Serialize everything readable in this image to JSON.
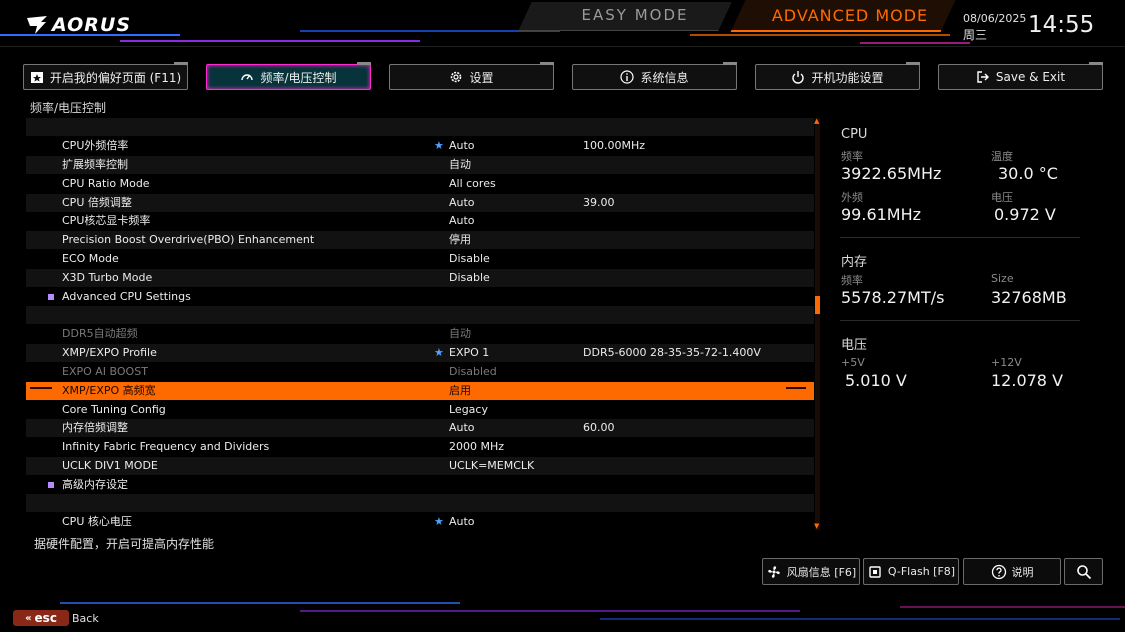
{
  "brand": "AORUS",
  "modes": {
    "easy": "EASY MODE",
    "advanced": "ADVANCED MODE"
  },
  "datetime": {
    "date": "08/06/2025",
    "weekday": "周三",
    "time": "14:55"
  },
  "tabs": [
    {
      "label": "开启我的偏好页面 (F11)",
      "icon": "star-box-icon",
      "active": false
    },
    {
      "label": "频率/电压控制",
      "icon": "gauge-icon",
      "active": true
    },
    {
      "label": "设置",
      "icon": "gear-icon",
      "active": false
    },
    {
      "label": "系统信息",
      "icon": "info-icon",
      "active": false
    },
    {
      "label": "开机功能设置",
      "icon": "power-icon",
      "active": false
    },
    {
      "label": "Save & Exit",
      "icon": "exit-icon",
      "active": false
    }
  ],
  "breadcrumb": "频率/电压控制",
  "settings": [
    {
      "label": "",
      "value": "",
      "extra": ""
    },
    {
      "label": "CPU外频倍率",
      "value": "Auto",
      "extra": "100.00MHz",
      "star": true
    },
    {
      "label": "扩展频率控制",
      "value": "自动",
      "extra": ""
    },
    {
      "label": "CPU Ratio Mode",
      "value": "All cores",
      "extra": ""
    },
    {
      "label": "CPU 倍频调整",
      "value": "Auto",
      "extra": "39.00"
    },
    {
      "label": "CPU核芯显卡频率",
      "value": "Auto",
      "extra": ""
    },
    {
      "label": "Precision Boost Overdrive(PBO) Enhancement",
      "value": "停用",
      "extra": ""
    },
    {
      "label": "ECO Mode",
      "value": "Disable",
      "extra": ""
    },
    {
      "label": "X3D Turbo Mode",
      "value": "Disable",
      "extra": ""
    },
    {
      "label": "Advanced CPU Settings",
      "value": "",
      "extra": "",
      "submenu": true
    },
    {
      "label": "",
      "value": "",
      "extra": ""
    },
    {
      "label": "DDR5自动超频",
      "value": "自动",
      "extra": "",
      "dim": true
    },
    {
      "label": "XMP/EXPO Profile",
      "value": "EXPO 1",
      "extra": "DDR5-6000 28-35-35-72-1.400V",
      "star": true
    },
    {
      "label": "EXPO AI BOOST",
      "value": "Disabled",
      "extra": "",
      "dim": true
    },
    {
      "label": "XMP/EXPO 高频宽",
      "value": "启用",
      "extra": "",
      "selected": true
    },
    {
      "label": "Core Tuning Config",
      "value": "Legacy",
      "extra": ""
    },
    {
      "label": "内存倍频调整",
      "value": "Auto",
      "extra": "60.00"
    },
    {
      "label": "Infinity Fabric Frequency and Dividers",
      "value": "2000 MHz",
      "extra": ""
    },
    {
      "label": "UCLK DIV1 MODE",
      "value": "UCLK=MEMCLK",
      "extra": ""
    },
    {
      "label": "高级内存设定",
      "value": "",
      "extra": "",
      "submenu": true
    },
    {
      "label": "",
      "value": "",
      "extra": ""
    },
    {
      "label": "CPU 核心电压",
      "value": "Auto",
      "extra": "",
      "star": true
    }
  ],
  "hint": "据硬件配置，开启可提高内存性能",
  "panel": {
    "cpu": {
      "title": "CPU",
      "freq_label": "频率",
      "freq": "3922.65MHz",
      "temp_label": "温度",
      "temp": "30.0 °C",
      "bclk_label": "外频",
      "bclk": "99.61MHz",
      "volt_label": "电压",
      "volt": "0.972 V"
    },
    "memory": {
      "title": "内存",
      "freq_label": "频率",
      "freq": "5578.27MT/s",
      "size_label": "Size",
      "size": "32768MB"
    },
    "voltage": {
      "title": "电压",
      "v5_label": "+5V",
      "v5": "5.010 V",
      "v12_label": "+12V",
      "v12": "12.078 V"
    }
  },
  "bottom_buttons": {
    "fan": "风扇信息 [F6]",
    "qflash": "Q-Flash [F8]",
    "help": "说明"
  },
  "esc": {
    "key": "esc",
    "label": "Back"
  },
  "colors": {
    "accent": "#ff6a00",
    "active_tab_border": "#ff2bd0",
    "active_tab_bg": "#06343a",
    "star": "#4fa3ff"
  }
}
